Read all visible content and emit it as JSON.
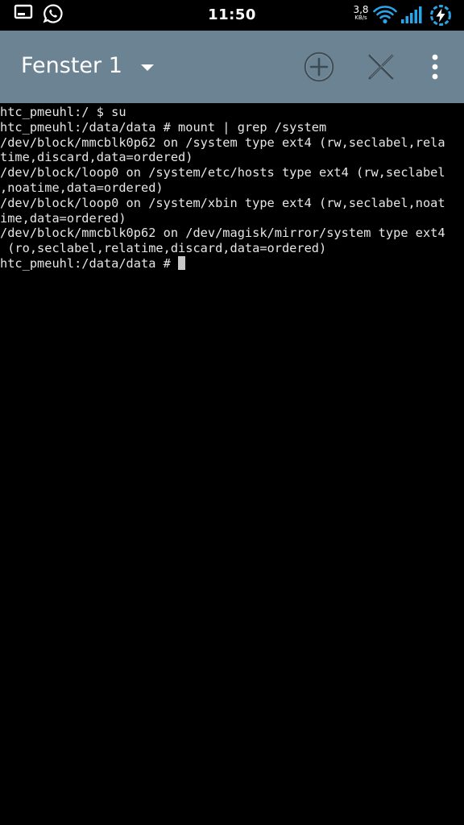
{
  "status_bar": {
    "time": "11:50",
    "net_speed_value": "3,8",
    "net_speed_unit": "KB/s",
    "left_icons": [
      "screenshot-icon",
      "whatsapp-icon"
    ],
    "right_icons": [
      "wifi-icon",
      "signal-icon",
      "battery-charging-icon"
    ]
  },
  "action_bar": {
    "title": "Fenster 1",
    "background_color": "#6b8393",
    "icons": [
      "dropdown-arrow-icon",
      "add-circle-icon",
      "close-icon",
      "overflow-menu-icon"
    ]
  },
  "terminal": {
    "lines": [
      "htc_pmeuhl:/ $ su",
      "htc_pmeuhl:/data/data # mount | grep /system",
      "/dev/block/mmcblk0p62 on /system type ext4 (rw,seclabel,rela",
      "time,discard,data=ordered)",
      "/dev/block/loop0 on /system/etc/hosts type ext4 (rw,seclabel",
      ",noatime,data=ordered)",
      "/dev/block/loop0 on /system/xbin type ext4 (rw,seclabel,noat",
      "ime,data=ordered)",
      "/dev/block/mmcblk0p62 on /dev/magisk/mirror/system type ext4",
      " (ro,seclabel,relatime,discard,data=ordered)"
    ],
    "prompt": "htc_pmeuhl:/data/data # ",
    "text_color": "#e6e6e6",
    "background_color": "#000000"
  }
}
